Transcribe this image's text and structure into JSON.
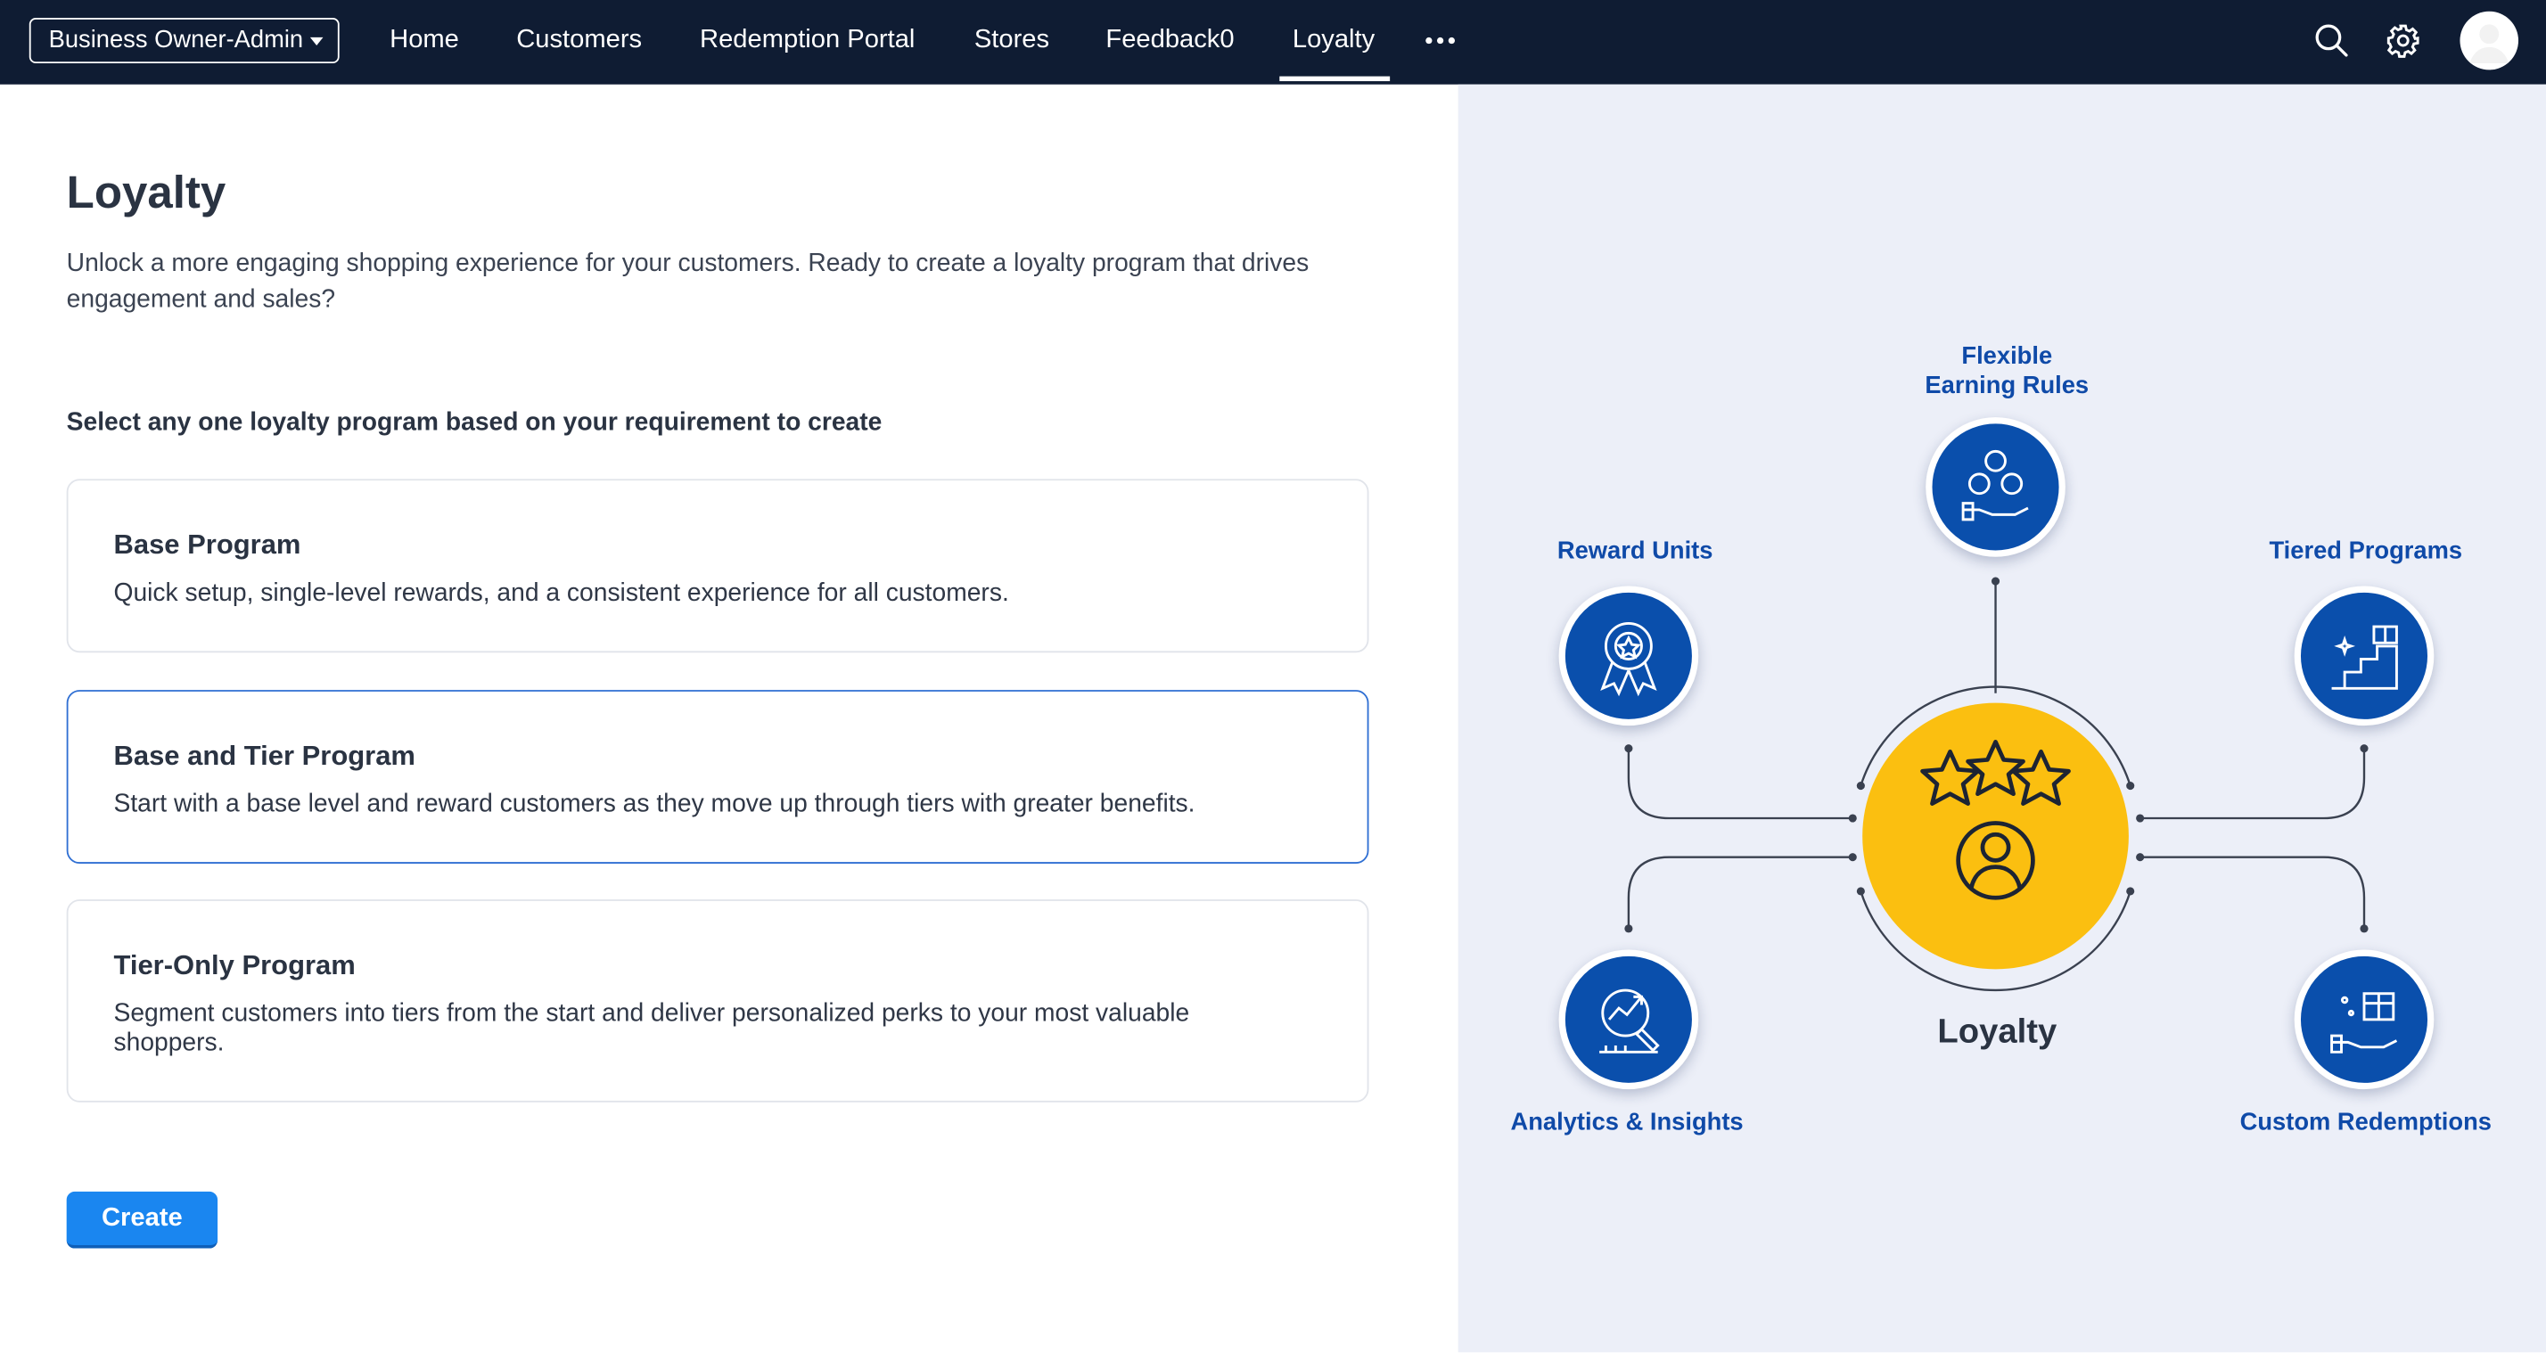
{
  "topnav": {
    "org_select": "Business Owner-Admin",
    "items": [
      {
        "label": "Home"
      },
      {
        "label": "Customers"
      },
      {
        "label": "Redemption Portal"
      },
      {
        "label": "Stores"
      },
      {
        "label": "Feedback0"
      },
      {
        "label": "Loyalty",
        "active": true
      }
    ],
    "more_icon": "more-horizontal-icon",
    "right_icons": [
      "search-icon",
      "gear-icon",
      "user-avatar"
    ]
  },
  "main": {
    "title": "Loyalty",
    "description": "Unlock a more engaging shopping experience for your customers. Ready to create a loyalty program that drives engagement and sales?",
    "select_label": "Select any one loyalty program based on your requirement to create",
    "programs": [
      {
        "title": "Base Program",
        "description": "Quick setup, single-level rewards, and a consistent experience for all customers.",
        "selected": false
      },
      {
        "title": "Base and Tier Program",
        "description": "Start with a base level and reward customers as they move up through tiers with greater benefits.",
        "selected": true
      },
      {
        "title": "Tier-Only Program",
        "description": "Segment customers into tiers from the start and deliver personalized perks to your most valuable shoppers.",
        "selected": false
      }
    ],
    "create_label": "Create"
  },
  "illustration": {
    "center_label": "Loyalty",
    "features": [
      {
        "label": "Flexible\nEarning Rules",
        "icon": "coins-hand-icon"
      },
      {
        "label": "Reward Units",
        "icon": "award-badge-icon"
      },
      {
        "label": "Tiered Programs",
        "icon": "gift-steps-icon"
      },
      {
        "label": "Analytics & Insights",
        "icon": "analytics-magnifier-icon"
      },
      {
        "label": "Custom Redemptions",
        "icon": "gift-hand-icon"
      }
    ],
    "colors": {
      "primary": "#0a4fac",
      "accent": "#fbbf10",
      "label": "#0f4aa8",
      "panel": "#eceff8"
    }
  }
}
